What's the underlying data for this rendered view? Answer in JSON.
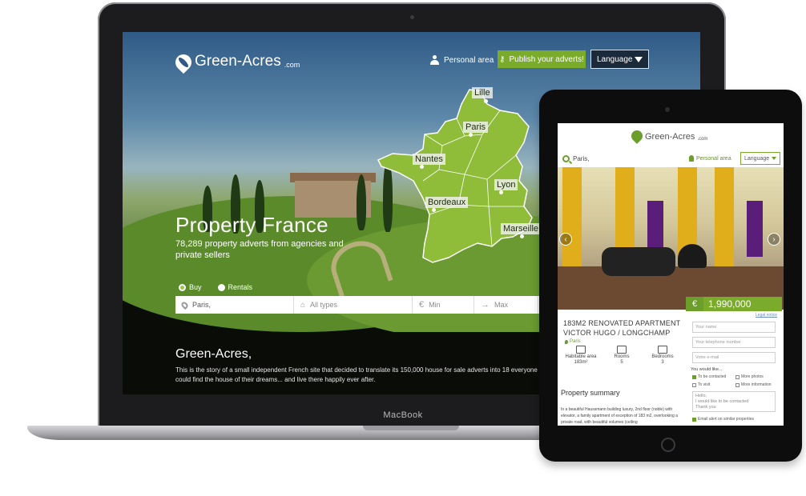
{
  "laptop": {
    "brand": "MacBook"
  },
  "site": {
    "logo_text": "Green-Acres",
    "logo_suffix": ".com",
    "nav": {
      "personal_area": "Personal area",
      "publish_button": "Publish your adverts!",
      "language_select": "Language"
    },
    "map_cities": [
      "Lille",
      "Paris",
      "Nantes",
      "Lyon",
      "Bordeaux",
      "Marseille"
    ],
    "hero": {
      "title": "Property France",
      "subtitle": "78,289 property adverts from agencies and private sellers"
    },
    "search": {
      "radio_buy": "Buy",
      "radio_rentals": "Rentals",
      "location_value": "Paris,",
      "type_placeholder": "All types",
      "min_placeholder": "Min",
      "max_placeholder": "Max"
    },
    "about": {
      "title": "Green-Acres,",
      "text": "This is the story of a small independent French site that decided to translate its 150,000 house for sale adverts into 18 everyone could find the house of their dreams... and live there happily ever after."
    }
  },
  "tablet": {
    "logo_text": "Green-Acres",
    "logo_suffix": ".com",
    "search_value": "Paris,",
    "personal_area": "Personal area",
    "language_select": "Language",
    "price_currency": "€",
    "price": "1,990,000",
    "listing_title": "183M2 RENOVATED APARTMENT VICTOR HUGO / LONGCHAMP",
    "city": "Paris",
    "stats": [
      {
        "label": "Habitable area",
        "value": "183m²"
      },
      {
        "label": "Rooms",
        "value": "5"
      },
      {
        "label": "Bedrooms",
        "value": "3"
      }
    ],
    "summary_title": "Property summary",
    "summary_text": "In a beautiful Haussmann building luxury, 2nd floor (noble) with elevator, a family apartment of exception of 183 m2, overlooking a private road, with beautiful volumes (ceiling",
    "form": {
      "legal_notice": "Legal notice",
      "name_placeholder": "Your name",
      "phone_placeholder": "Your telephone number",
      "email_placeholder": "Votre e-mail",
      "would_like": "You would like...",
      "option_contacted": "To be contacted",
      "option_photos": "More photos",
      "option_visit": "To visit",
      "option_information": "More information",
      "message_placeholder": "Hello,\nI would like to be contacted\nThank you",
      "email_alert": "Email alert on similar properties"
    }
  },
  "colors": {
    "brand_green": "#7bab2b",
    "map_green": "#8fbd3a",
    "dark": "#0a0c08"
  }
}
